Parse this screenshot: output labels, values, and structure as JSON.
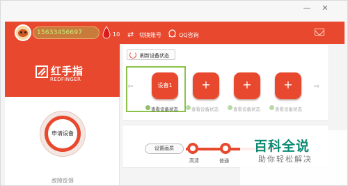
{
  "header": {
    "phone": "15633456697",
    "gem_count": "10",
    "switch_account_label": "切换账号",
    "qq_label": "QQ咨询",
    "accent_color": "#e8492e"
  },
  "brand": {
    "name": "红手指",
    "subtitle": "REDFINGER"
  },
  "sidebar": {
    "apply_label": "申请设备",
    "feedback_label": "故障反馈"
  },
  "device_panel": {
    "refresh_label": "刷新设备状态",
    "slots": [
      {
        "label": "设备1",
        "status": "查看设备状态",
        "selected": true
      },
      {
        "label": "+",
        "status": "查看设备状态"
      },
      {
        "label": "+",
        "status": "查看设备状态"
      },
      {
        "label": "+",
        "status": "查看设备状态"
      }
    ],
    "prev_icon": "arrow-left-icon",
    "next_icon": "arrow-right-icon"
  },
  "quality": {
    "label": "设置画质",
    "options": [
      "高清",
      "普通"
    ]
  },
  "watermark": {
    "title": "百科全说",
    "subtitle": "助你轻松解决"
  }
}
